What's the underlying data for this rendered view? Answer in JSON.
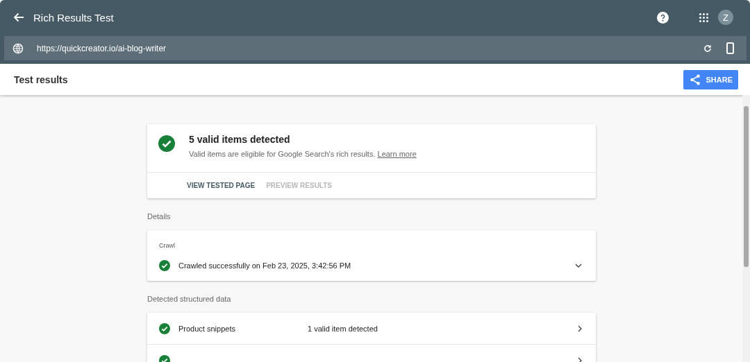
{
  "app_bar": {
    "title": "Rich Results Test",
    "account_initial": "Z"
  },
  "url_bar": {
    "value": "https://quickcreator.io/ai-blog-writer"
  },
  "header": {
    "title": "Test results",
    "share_button": "SHARE"
  },
  "summary": {
    "valid": true,
    "title": "5 valid items detected",
    "description": "Valid items are eligible for Google Search's rich results.",
    "link": "Learn more",
    "actions": [
      {
        "label": "VIEW TESTED PAGE",
        "disabled": false
      },
      {
        "label": "PREVIEW RESULTS",
        "disabled": true
      }
    ]
  },
  "details": {
    "label": "Details",
    "card_title": "Crawl",
    "valid": true,
    "status": "Crawled successfully on Feb 23, 2025, 3:42:56 PM"
  },
  "structured_data": {
    "label": "Detected structured data",
    "rows": [
      {
        "valid": true,
        "name": "Product snippets",
        "status": "1 valid item detected"
      },
      {
        "valid": true
      }
    ]
  }
}
